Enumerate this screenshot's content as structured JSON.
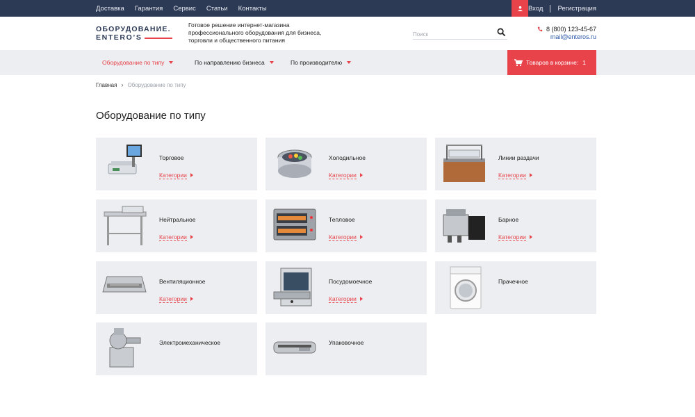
{
  "topbar": {
    "nav": [
      "Доставка",
      "Гарантия",
      "Сервис",
      "Статьи",
      "Контакты"
    ],
    "login": "Вход",
    "register": "Регистрация"
  },
  "header": {
    "logo_line1": "ОБОРУДОВАНИЕ.",
    "logo_line2": "ENTERO’S",
    "tagline": "Готовое решение интернет-магазина профессионального оборудования для бизнеса, торговли и общественного питания",
    "search_placeholder": "Поиск",
    "phone": "8 (800) 123-45-67",
    "email": "mail@enteros.ru"
  },
  "catnav": {
    "items": [
      "Оборудование по типу",
      "По направлению бизнеса",
      "По производителю"
    ],
    "cart_label": "Товаров в корзине:",
    "cart_count": "1"
  },
  "breadcrumb": {
    "home": "Главная",
    "current": "Оборудование по типу"
  },
  "page_title": "Оборудование по типу",
  "categories_link": "Категории",
  "cards": [
    {
      "name": "Торговое",
      "has_link": true,
      "icon": "scale"
    },
    {
      "name": "Холодильное",
      "has_link": true,
      "icon": "cooler"
    },
    {
      "name": "Линии раздачи",
      "has_link": true,
      "icon": "counter"
    },
    {
      "name": "Нейтральное",
      "has_link": true,
      "icon": "table"
    },
    {
      "name": "Тепловое",
      "has_link": true,
      "icon": "oven"
    },
    {
      "name": "Барное",
      "has_link": true,
      "icon": "coffee"
    },
    {
      "name": "Вентиляционное",
      "has_link": true,
      "icon": "hood"
    },
    {
      "name": "Посудомоечное",
      "has_link": true,
      "icon": "dishwasher"
    },
    {
      "name": "Прачечное",
      "has_link": false,
      "icon": "washer"
    },
    {
      "name": "Электромеханическое",
      "has_link": false,
      "icon": "grinder"
    },
    {
      "name": "Упаковочное",
      "has_link": false,
      "icon": "vacuum"
    }
  ],
  "colors": {
    "accent": "#e8424a",
    "topbar": "#2d3a55",
    "card_bg": "#eceef1"
  }
}
